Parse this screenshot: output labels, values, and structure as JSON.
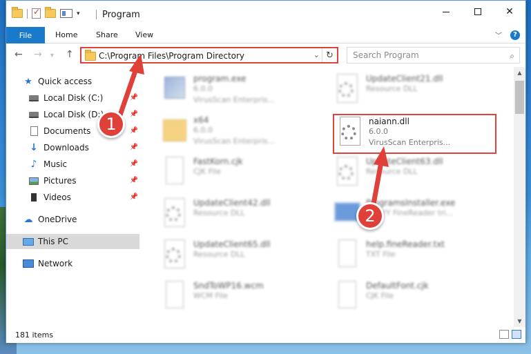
{
  "window": {
    "title": "Program",
    "quick_access_dropdown": "▾"
  },
  "ribbon": {
    "file_tab": "File",
    "home_tab": "Home",
    "share_tab": "Share",
    "view_tab": "View",
    "help_label": "?"
  },
  "navigation": {
    "back": "←",
    "forward": "→",
    "up": "↑",
    "address_path": "C:\\Program Files\\Program Directory",
    "refresh": "↻",
    "search_placeholder": "Search Program"
  },
  "sidebar": {
    "items": [
      {
        "label": "Quick access",
        "icon": "star-icon",
        "pinned": false
      },
      {
        "label": "Local Disk (C:)",
        "icon": "disk-icon",
        "pinned": true
      },
      {
        "label": "Local Disk (D:)",
        "icon": "disk-icon",
        "pinned": true
      },
      {
        "label": "Documents",
        "icon": "documents-icon",
        "pinned": true
      },
      {
        "label": "Downloads",
        "icon": "download-icon",
        "pinned": true
      },
      {
        "label": "Music",
        "icon": "music-icon",
        "pinned": true
      },
      {
        "label": "Pictures",
        "icon": "pictures-icon",
        "pinned": true
      },
      {
        "label": "Videos",
        "icon": "videos-icon",
        "pinned": true
      },
      {
        "label": "OneDrive",
        "icon": "onedrive-icon",
        "pinned": false
      },
      {
        "label": "This PC",
        "icon": "computer-icon",
        "pinned": false,
        "selected": true
      },
      {
        "label": "Network",
        "icon": "network-icon",
        "pinned": false
      }
    ]
  },
  "files": [
    {
      "name": "program.exe",
      "line2": "6.0.0",
      "line3": "VirusScan Enterpris...",
      "icon": "exe-icon"
    },
    {
      "name": "UpdateClient21.dll",
      "line2": "Resource DLL",
      "line3": "",
      "icon": "dll-icon"
    },
    {
      "name": "x64",
      "line2": "6.0.0",
      "line3": "VirusScan Enterpris...",
      "icon": "folder-icon"
    },
    {
      "name": "naiann.dll",
      "line2": "6.0.0",
      "line3": "VirusScan Enterpris...",
      "icon": "dll-icon"
    },
    {
      "name": "FastKorn.cjk",
      "line2": "CJK File",
      "line3": "",
      "icon": "file-icon"
    },
    {
      "name": "UpdateClient63.dll",
      "line2": "Resource DLL",
      "line3": "",
      "icon": "dll-icon"
    },
    {
      "name": "UpdateClient42.dll",
      "line2": "Resource DLL",
      "line3": "",
      "icon": "dll-icon"
    },
    {
      "name": "ProgramsInstaller.exe",
      "line2": "ABBYY FineReader tri...",
      "line3": "",
      "icon": "installer-icon"
    },
    {
      "name": "UpdateClient65.dll",
      "line2": "Resource DLL",
      "line3": "",
      "icon": "dll-icon"
    },
    {
      "name": "help.fineReader.txt",
      "line2": "TXT File",
      "line3": "",
      "icon": "text-file-icon"
    },
    {
      "name": "SndToWP16.wcm",
      "line2": "WCM File",
      "line3": "",
      "icon": "file-icon"
    },
    {
      "name": "DefaultFont.cjk",
      "line2": "CJK File",
      "line3": "",
      "icon": "file-icon"
    }
  ],
  "status": {
    "item_count": "181 items"
  },
  "annotations": {
    "badge_1": "1",
    "badge_2": "2",
    "color": "#e0403a"
  },
  "colors": {
    "accent": "#1979ca",
    "highlight_border": "#e0403a",
    "selected_bg": "#d9d9d9"
  }
}
